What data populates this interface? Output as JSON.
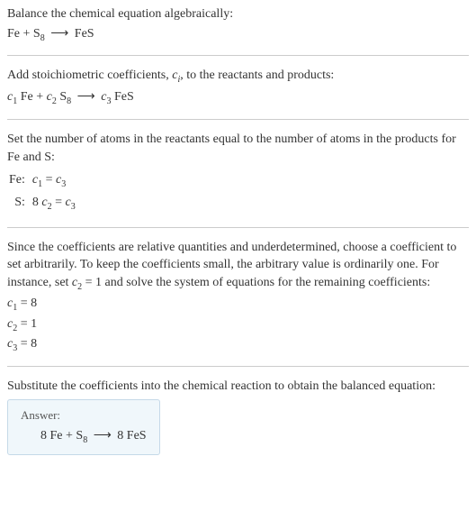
{
  "section1": {
    "intro": "Balance the chemical equation algebraically:",
    "eq": {
      "r1": "Fe",
      "plus": " + ",
      "r2a": "S",
      "r2b": "8",
      "arr": "⟶",
      "p1": "FeS"
    }
  },
  "section2": {
    "intro_a": "Add stoichiometric coefficients, ",
    "intro_c": "c",
    "intro_i": "i",
    "intro_b": ", to the reactants and products:",
    "eq": {
      "c1a": "c",
      "c1b": "1",
      "r1": " Fe",
      "plus": " + ",
      "c2a": "c",
      "c2b": "2",
      "r2a": " S",
      "r2b": "8",
      "arr": "⟶",
      "c3a": "c",
      "c3b": "3",
      "p1": " FeS"
    }
  },
  "section3": {
    "intro": "Set the number of atoms in the reactants equal to the number of atoms in the products for Fe and S:",
    "rows": [
      {
        "label": "Fe:",
        "lhs_c": "c",
        "lhs_i": "1",
        "eq": " = ",
        "rhs_c": "c",
        "rhs_i": "3",
        "pre": ""
      },
      {
        "label": "S:",
        "lhs_c": "c",
        "lhs_i": "2",
        "eq": " = ",
        "rhs_c": "c",
        "rhs_i": "3",
        "pre": "8 "
      }
    ]
  },
  "section4": {
    "intro_a": "Since the coefficients are relative quantities and underdetermined, choose a coefficient to set arbitrarily. To keep the coefficients small, the arbitrary value is ordinarily one. For instance, set ",
    "set_c": "c",
    "set_i": "2",
    "set_eq": " = 1",
    "intro_b": " and solve the system of equations for the remaining coefficients:",
    "coeffs": [
      {
        "c": "c",
        "i": "1",
        "v": " = 8"
      },
      {
        "c": "c",
        "i": "2",
        "v": " = 1"
      },
      {
        "c": "c",
        "i": "3",
        "v": " = 8"
      }
    ]
  },
  "section5": {
    "intro": "Substitute the coefficients into the chemical reaction to obtain the balanced equation:",
    "answer_label": "Answer:",
    "eq": {
      "r1": "8 Fe",
      "plus": " + ",
      "r2a": "S",
      "r2b": "8",
      "arr": "⟶",
      "p1": "8 FeS"
    }
  }
}
